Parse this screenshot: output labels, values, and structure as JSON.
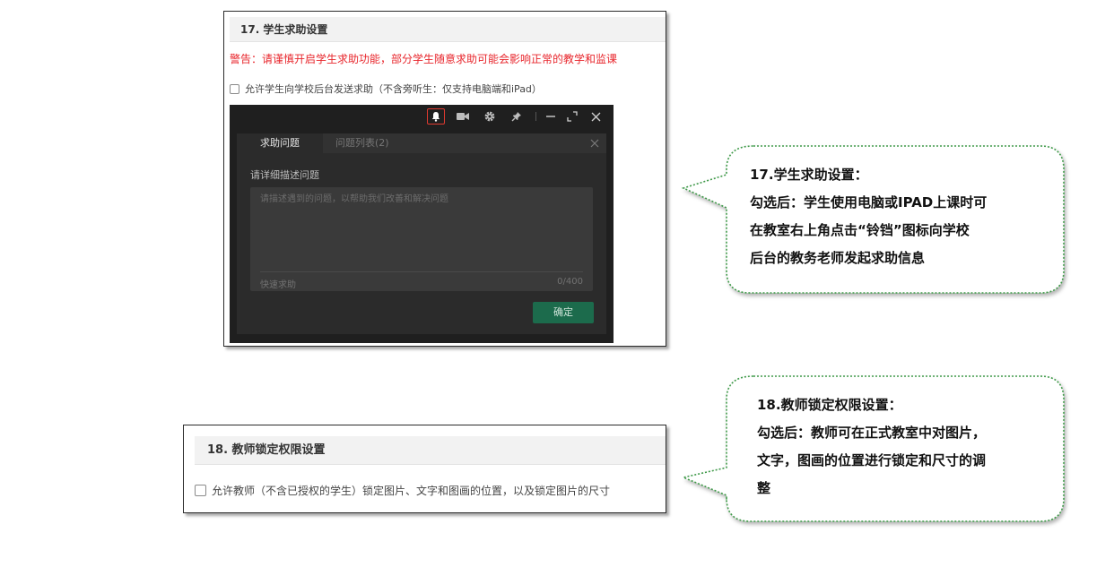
{
  "section17": {
    "title": "17. 学生求助设置",
    "warning": "警告：请谨慎开启学生求助功能，部分学生随意求助可能会影响正常的教学和监课",
    "checkbox_label": "允许学生向学校后台发送求助（不含旁听生：仅支持电脑端和iPad）",
    "client": {
      "toolbar_icons": [
        "bell-icon",
        "camera-icon",
        "gear-icon",
        "pin-icon",
        "minimize-icon",
        "fullscreen-icon",
        "close-icon"
      ],
      "highlight_color": "#e03a30",
      "tab_active": "求助问题",
      "tab_inactive": "问题列表(2)",
      "prompt": "请详细描述问题",
      "placeholder": "请描述遇到的问题，以帮助我们改善和解决问题",
      "quick_help": "快速求助",
      "counter": "0/400",
      "confirm_label": "确定",
      "confirm_color": "#1c6b4c"
    }
  },
  "section18": {
    "title": "18. 教师锁定权限设置",
    "checkbox_label": "允许教师（不含已授权的学生）锁定图片、文字和图画的位置，以及锁定图片的尺寸"
  },
  "callout17": {
    "lines": [
      "17.学生求助设置：",
      "勾选后：学生使用电脑或IPAD上课时可",
      "在教室右上角点击“铃铛”图标向学校",
      "后台的教务老师发起求助信息"
    ]
  },
  "callout18": {
    "lines": [
      "18.教师锁定权限设置：",
      "勾选后：教师可在正式教室中对图片，",
      "文字，图画的位置进行锁定和尺寸的调",
      "整"
    ]
  },
  "colors": {
    "callout_border": "#3f9a4a",
    "warning": "#e8262c"
  }
}
